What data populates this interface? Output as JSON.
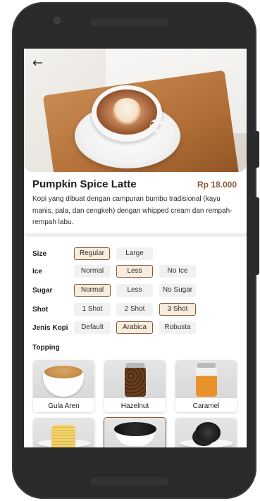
{
  "product": {
    "name": "Pumpkin Spice Latte",
    "price": "Rp 18.000",
    "description": "Kopi yang dibuat dengan campuran bumbu tradisional (kayu manis, pala, dan cengkeh) dengan whipped cream dan rempah-rempah labu."
  },
  "options": {
    "size": {
      "label": "Size",
      "choices": [
        "Regular",
        "Large"
      ],
      "selected": "Regular"
    },
    "ice": {
      "label": "Ice",
      "choices": [
        "Normal",
        "Less",
        "No Ice"
      ],
      "selected": "Less"
    },
    "sugar": {
      "label": "Sugar",
      "choices": [
        "Normal",
        "Less",
        "No Sugar"
      ],
      "selected": "Normal"
    },
    "shot": {
      "label": "Shot",
      "choices": [
        "1 Shot",
        "2 Shot",
        "3 Shot"
      ],
      "selected": "3 Shot"
    },
    "jenis_kopi": {
      "label": "Jenis Kopi",
      "choices": [
        "Default",
        "Arabica",
        "Robusta"
      ],
      "selected": "Arabica"
    }
  },
  "topping": {
    "label": "Topping",
    "items": [
      "Gula Aren",
      "Hazelnut",
      "Caramel"
    ]
  },
  "colors": {
    "accent": "#8a5a36",
    "chip_bg": "#f1f1f1",
    "selected_bg": "#f6ecdf"
  }
}
